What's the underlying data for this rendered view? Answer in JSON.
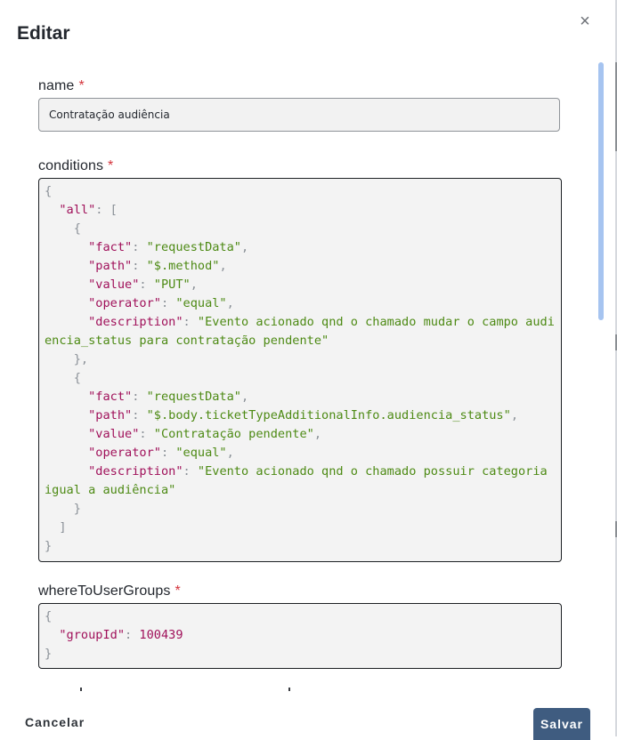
{
  "dialog": {
    "title": "Editar",
    "close_symbol": "×"
  },
  "fields": {
    "name": {
      "label": "name",
      "required_mark": "*",
      "value": "Contratação audiência"
    },
    "conditions": {
      "label": "conditions",
      "required_mark": "*"
    },
    "whereToUserGroups": {
      "label": "whereToUserGroups",
      "required_mark": "*"
    }
  },
  "conditions_code": {
    "open_brace": "{",
    "all_key": "\"all\"",
    "open_bracket": "[",
    "rule1": {
      "fact": "\"requestData\"",
      "path": "\"$.method\"",
      "value": "\"PUT\"",
      "operator": "\"equal\"",
      "description": "\"Evento acionado qnd o chamado mudar o campo audiencia_status para contratação pendente\""
    },
    "rule2": {
      "fact": "\"requestData\"",
      "path": "\"$.body.ticketTypeAdditionalInfo.audiencia_status\"",
      "value": "\"Contratação pendente\"",
      "operator": "\"equal\"",
      "description": "\"Evento acionado qnd o chamado possuir categoria igual a audiência\""
    },
    "keys": {
      "fact": "\"fact\"",
      "path": "\"path\"",
      "value": "\"value\"",
      "operator": "\"operator\"",
      "description": "\"description\""
    },
    "close_bracket": "]",
    "close_brace": "}"
  },
  "groups_code": {
    "open_brace": "{",
    "groupId_key": "\"groupId\"",
    "groupId_value": "100439",
    "close_brace": "}"
  },
  "actions": {
    "cancel_label": "Cancelar",
    "save_label": "Salvar"
  }
}
